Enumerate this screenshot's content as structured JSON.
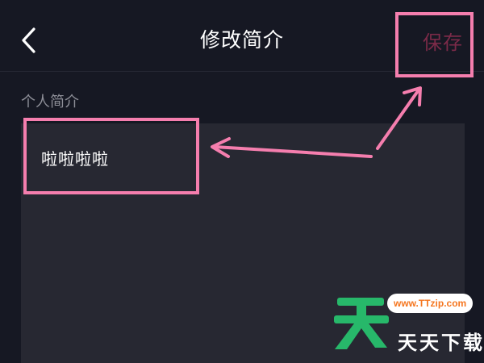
{
  "header": {
    "title": "修改简介",
    "save_label": "保存"
  },
  "section": {
    "label": "个人简介"
  },
  "bio": {
    "value": "啦啦啦啦"
  },
  "watermark": {
    "url": "www.TTzip.com",
    "name": "天天下载"
  },
  "colors": {
    "background": "#161823",
    "textarea_background": "#272832",
    "save_disabled": "#7b2a48",
    "highlight": "#f57eae",
    "label": "#8e8f98"
  },
  "icons": {
    "back": "chevron-left-icon",
    "arrow": "arrow-icon"
  }
}
